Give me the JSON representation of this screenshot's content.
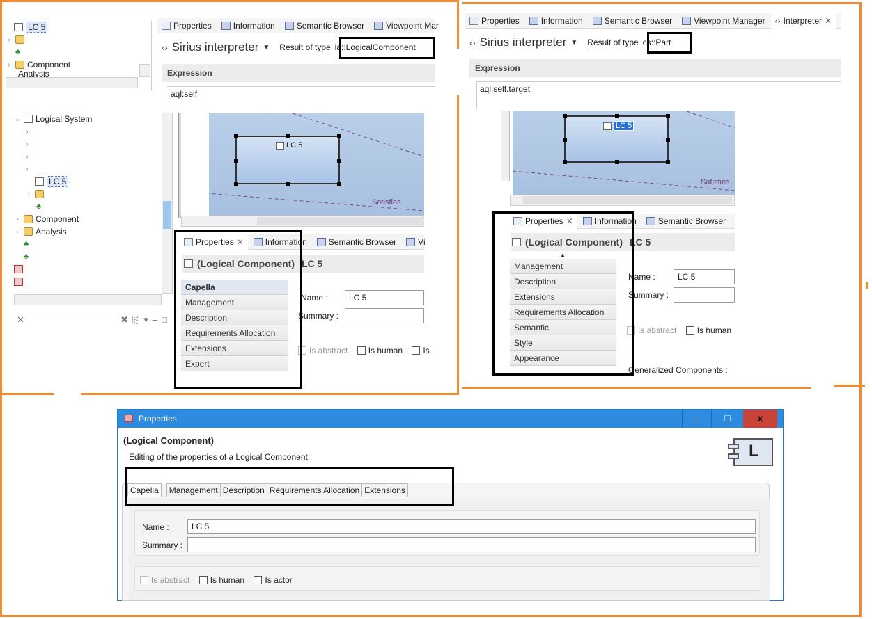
{
  "colors": {
    "accent": "#f28a30",
    "titlebar": "#2d8be0",
    "close": "#c9433a"
  },
  "p1": {
    "tree_top": {
      "lc5": "LC 5",
      "component": "Component",
      "analysis": "Analysis"
    },
    "tabs": {
      "properties": "Properties",
      "information": "Information",
      "semantic_browser": "Semantic Browser",
      "viewpoint_manager": "Viewpoint Mar"
    },
    "interpreter_title": "Sirius interpreter",
    "result_prefix": "Result of type",
    "result_type": "la::LogicalComponent",
    "expression_label": "Expression",
    "expression_value": "aql:self"
  },
  "p2": {
    "tree": {
      "logical_system": "Logical System",
      "lc5": "LC 5",
      "component": "Component",
      "analysis": "Analysis"
    },
    "node_label": "LC 5",
    "satisfies": "Satisfies",
    "tabs": {
      "properties": "Properties",
      "information": "Information",
      "semantic_browser": "Semantic Browser",
      "vi": "Vi"
    },
    "title_type": "(Logical Component)",
    "title_name": "LC 5",
    "side_tabs": [
      "Capella",
      "Management",
      "Description",
      "Requirements Allocation",
      "Extensions",
      "Expert"
    ],
    "name_label": "Name :",
    "name_value": "LC 5",
    "summary_label": "Summary :",
    "checks": {
      "is_abstract": "Is abstract",
      "is_human": "Is human",
      "is": "Is"
    }
  },
  "p3": {
    "tabs": {
      "properties": "Properties",
      "information": "Information",
      "semantic_browser": "Semantic Browser",
      "viewpoint_manager": "Viewpoint Manager",
      "interpreter": "Interpreter"
    },
    "interpreter_title": "Sirius interpreter",
    "result_prefix": "Result of type",
    "result_type": "cs::Part",
    "expression_label": "Expression",
    "expression_value": "aql:self.target",
    "node_label": "LC 5",
    "satisfies": "Satisfies",
    "prop_tabs": {
      "properties": "Properties",
      "information": "Information",
      "semantic_browser": "Semantic Browser"
    },
    "title_type": "(Logical Component)",
    "title_name": "LC 5",
    "side_tabs": [
      "Management",
      "Description",
      "Extensions",
      "Requirements Allocation",
      "Semantic",
      "Style",
      "Appearance"
    ],
    "name_label": "Name :",
    "name_value": "LC 5",
    "summary_label": "Summary :",
    "checks": {
      "is_abstract": "Is abstract",
      "is_human": "Is human"
    },
    "generalized": "Generalized Components :"
  },
  "dialog": {
    "title": "Properties",
    "heading": "(Logical Component)",
    "subheading": "Editing of the properties of a Logical Component",
    "big_icon_letter": "L",
    "tabs": [
      "Capella",
      "Management",
      "Description",
      "Requirements Allocation",
      "Extensions"
    ],
    "name_label": "Name :",
    "name_value": "LC 5",
    "summary_label": "Summary :",
    "checks": {
      "is_abstract": "Is abstract",
      "is_human": "Is human",
      "is_actor": "Is actor"
    },
    "buttons": {
      "minimize": "–",
      "maximize": "□",
      "close": "x"
    }
  }
}
